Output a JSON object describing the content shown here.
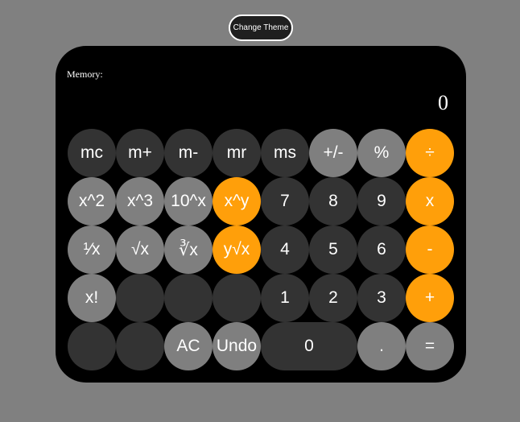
{
  "theme_button": {
    "label": "Change Theme"
  },
  "memory": {
    "label": "Memory:"
  },
  "display": {
    "value": "0"
  },
  "colors": {
    "background": "#808080",
    "panel": "#000000",
    "dark_key": "#333333",
    "light_key": "#7f7f7f",
    "operator_key": "#ff9f0a"
  },
  "keys": {
    "mc": "mc",
    "m_plus": "m+",
    "m_minus": "m-",
    "mr": "mr",
    "ms": "ms",
    "sign": "+/-",
    "percent": "%",
    "divide": "÷",
    "square": "x^2",
    "cube": "x^3",
    "ten_pow": "10^x",
    "x_pow_y": "x^y",
    "d7": "7",
    "d8": "8",
    "d9": "9",
    "multiply": "x",
    "reciprocal": "¹⁄x",
    "sqrt": "√x",
    "cbrt": "∛x",
    "y_root_x": "y√x",
    "d4": "4",
    "d5": "5",
    "d6": "6",
    "minus": "-",
    "factorial": "x!",
    "d1": "1",
    "d2": "2",
    "d3": "3",
    "plus": "+",
    "ac": "AC",
    "undo": "Undo",
    "d0": "0",
    "decimal": ".",
    "equals": "="
  }
}
